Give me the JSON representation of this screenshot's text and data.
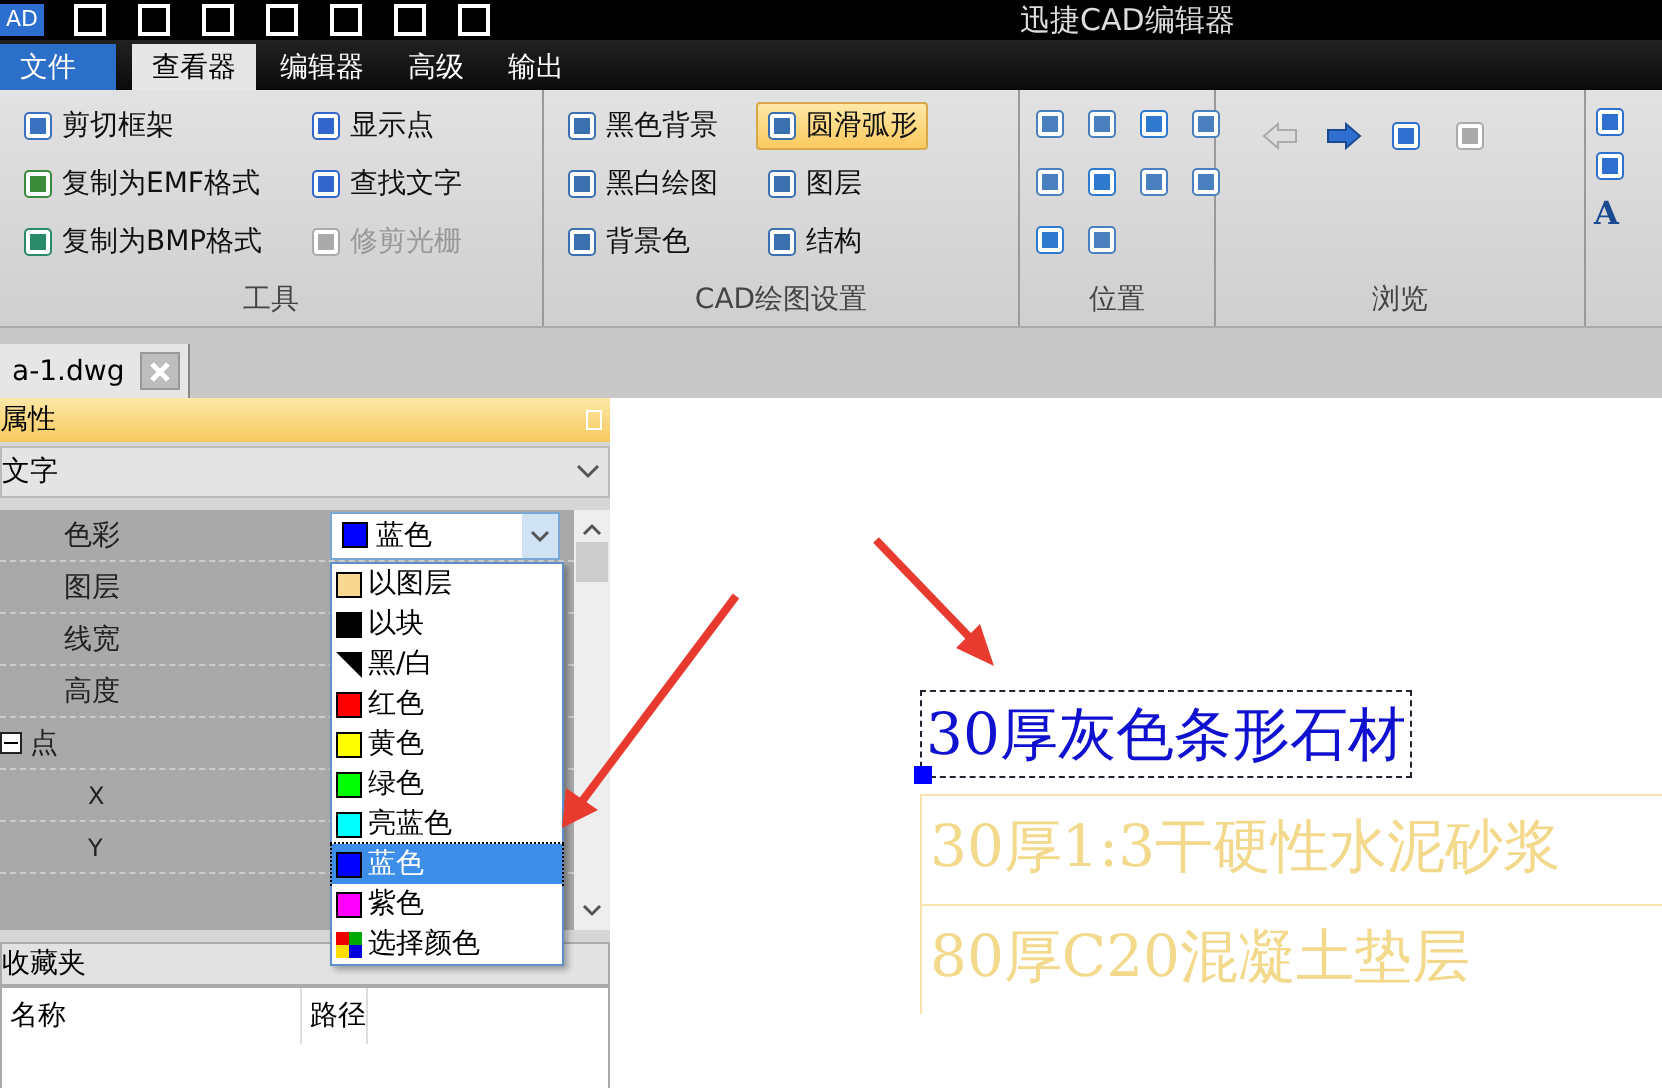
{
  "title_bar": {
    "logo": "AD",
    "title": "迅捷CAD编辑器"
  },
  "menu_tabs": [
    {
      "label": "文件",
      "kind": "file",
      "selected": false
    },
    {
      "label": "查看器",
      "kind": "tab",
      "selected": true
    },
    {
      "label": "编辑器",
      "kind": "tab",
      "selected": false
    },
    {
      "label": "高级",
      "kind": "tab",
      "selected": false
    },
    {
      "label": "输出",
      "kind": "tab",
      "selected": false
    }
  ],
  "ribbon": {
    "tools": {
      "label": "工具",
      "items": [
        {
          "label": "剪切框架",
          "disabled": false
        },
        {
          "label": "复制为EMF格式",
          "disabled": false
        },
        {
          "label": "复制为BMP格式",
          "disabled": false
        },
        {
          "label": "显示点",
          "disabled": false
        },
        {
          "label": "查找文字",
          "disabled": false
        },
        {
          "label": "修剪光栅",
          "disabled": true
        }
      ]
    },
    "drawing": {
      "label": "CAD绘图设置",
      "items": [
        {
          "label": "黑色背景",
          "on": false
        },
        {
          "label": "黑白绘图",
          "on": false
        },
        {
          "label": "背景色",
          "on": false
        },
        {
          "label": "圆滑弧形",
          "on": true
        },
        {
          "label": "图层",
          "on": false
        },
        {
          "label": "结构",
          "on": false
        }
      ]
    },
    "position": {
      "label": "位置"
    },
    "browse": {
      "label": "浏览",
      "buttons": [
        {
          "disabled": true
        },
        {
          "disabled": false
        },
        {
          "disabled": false
        },
        {
          "disabled": true
        }
      ]
    },
    "partial": {
      "glyph": "A"
    }
  },
  "doc_tab": {
    "label": "a-1.dwg"
  },
  "properties": {
    "title": "属性",
    "object_type": "文字",
    "rows": [
      {
        "name": "色彩",
        "kind": "color",
        "value": "蓝色",
        "color": "#0000ff"
      },
      {
        "name": "图层",
        "kind": "plain"
      },
      {
        "name": "线宽",
        "kind": "plain"
      },
      {
        "name": "高度",
        "kind": "plain"
      },
      {
        "name": "点",
        "kind": "group",
        "expanded": true,
        "children": [
          {
            "name": "X",
            "kind": "plain"
          },
          {
            "name": "Y",
            "kind": "plain"
          }
        ]
      }
    ],
    "color_options": [
      {
        "label": "以图层",
        "kind": "solid",
        "color": "#f8d890",
        "selected": false
      },
      {
        "label": "以块",
        "kind": "solid",
        "color": "#000000",
        "selected": false
      },
      {
        "label": "黑/白",
        "kind": "split",
        "selected": false
      },
      {
        "label": "红色",
        "kind": "solid",
        "color": "#ff0000",
        "selected": false
      },
      {
        "label": "黄色",
        "kind": "solid",
        "color": "#ffff00",
        "selected": false
      },
      {
        "label": "绿色",
        "kind": "solid",
        "color": "#00ff00",
        "selected": false
      },
      {
        "label": "亮蓝色",
        "kind": "solid",
        "color": "#00ffff",
        "selected": false
      },
      {
        "label": "蓝色",
        "kind": "solid",
        "color": "#0000ff",
        "selected": true
      },
      {
        "label": "紫色",
        "kind": "solid",
        "color": "#ff00ff",
        "selected": false
      },
      {
        "label": "选择颜色",
        "kind": "multi",
        "selected": false
      }
    ]
  },
  "favorites": {
    "title": "收藏夹",
    "columns": [
      "名称",
      "路径"
    ]
  },
  "canvas": {
    "texts": [
      {
        "text": "30厚灰色条形石材",
        "selected": true
      },
      {
        "text": "30厚1:3干硬性水泥砂浆",
        "selected": false
      },
      {
        "text": "80厚C20混凝土垫层",
        "selected": false
      }
    ]
  }
}
